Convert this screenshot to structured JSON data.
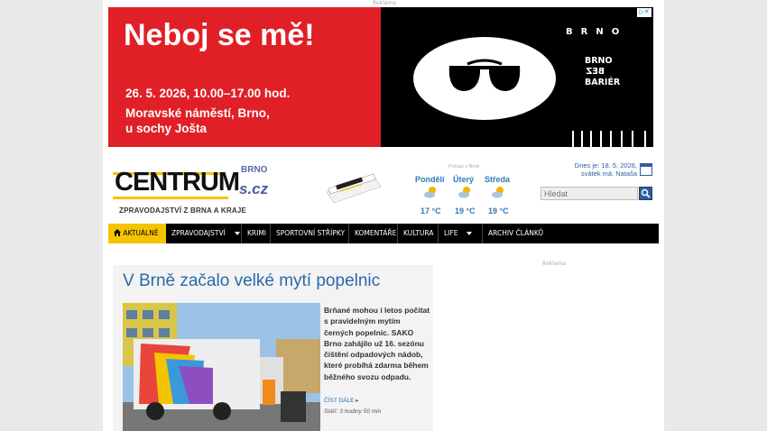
{
  "ads": {
    "top_label": "Reklama",
    "side_label": "Reklama"
  },
  "banner": {
    "headline": "Neboj se mě!",
    "date": "26. 5. 2026, 10.00–17.00 hod.",
    "place_line1": "Moravské náměstí, Brno,",
    "place_line2": "u sochy Jošta",
    "brno_spaced": "BRNO",
    "brand_line1": "BRNO",
    "brand_line2": "BEZ",
    "brand_line3": "BARIÉR",
    "adchoices": "▷✕",
    "left_color": "#e01f26",
    "right_color": "#000000"
  },
  "logo": {
    "main": "CENTRUM",
    "brno": "BRNO",
    "domain": "s.cz",
    "subtitle": "ZPRAVODAJSTVÍ Z BRNA A KRAJE"
  },
  "weather": {
    "label": "Počasí v Brně",
    "days": [
      {
        "name": "Pondělí",
        "temp": "17 °C",
        "icon": "partly-cloudy-icon"
      },
      {
        "name": "Úterý",
        "temp": "19 °C",
        "icon": "partly-cloudy-icon"
      },
      {
        "name": "Středa",
        "temp": "19 °C",
        "icon": "partly-cloudy-icon"
      }
    ]
  },
  "today": {
    "date": "Dnes je: 18. 5. 2026,",
    "nameday": "svátek má: Nataša"
  },
  "search": {
    "placeholder": "Hledat"
  },
  "nav": {
    "items": [
      {
        "label": "AKTUÁLNĚ"
      },
      {
        "label": "ZPRAVODAJSTVÍ"
      },
      {
        "label": "KRIMI"
      },
      {
        "label": "SPORTOVNÍ STŘÍPKY"
      },
      {
        "label": "KOMENTÁŘE"
      },
      {
        "label": "KULTURA"
      },
      {
        "label": "LIFE"
      },
      {
        "label": "ARCHIV ČLÁNKŮ"
      }
    ],
    "accent": "#f5c400"
  },
  "article": {
    "title": "V Brně začalo velké mytí popelnic",
    "body": "Brňané mohou i letos počítat s pravidelným mytím černých popelnic. SAKO Brno zahájilo už 16. sezónu čištění odpadových nádob, které probíhá zdarma během běžného svozu odpadu.",
    "more": "ČÍST DÁLE",
    "age": "Stáří: 3 hodiny 50 min",
    "title_color": "#2a6aa8"
  }
}
